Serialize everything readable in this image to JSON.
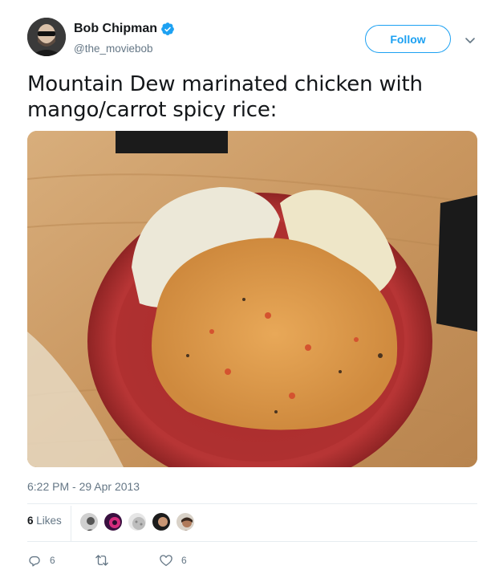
{
  "author": {
    "display_name": "Bob Chipman",
    "handle": "@the_moviebob",
    "verified": true,
    "avatar_icon": "user-avatar"
  },
  "follow_button": {
    "label": "Follow"
  },
  "tweet": {
    "text": "Mountain Dew marinated chicken with mango/carrot spicy rice:",
    "timestamp": "6:22 PM - 29 Apr 2013"
  },
  "stats": {
    "likes_number": "6",
    "likes_label": "Likes"
  },
  "actions": {
    "reply_count": "6",
    "retweet_count": "",
    "like_count": "6"
  },
  "colors": {
    "accent": "#1da1f2",
    "secondary_text": "#657786",
    "border": "#e6ecf0"
  }
}
